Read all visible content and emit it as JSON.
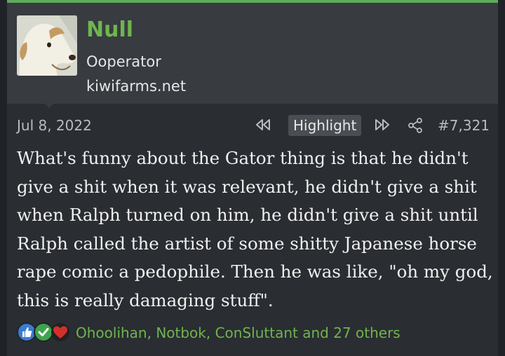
{
  "user": {
    "name": "Null",
    "title": "Ooperator",
    "banner": "kiwifarms.net"
  },
  "post": {
    "date": "Jul 8, 2022",
    "highlight_label": "Highlight",
    "number": "#7,321",
    "body": "What's funny about the Gator thing is that he didn't give a shit when it was relevant, he didn't give a shit when Ralph turned on him, he didn't give a shit until Ralph called the artist of some shitty Japanese horse rape comic a pedophile. Then he was like, \"oh my god, this is really damaging stuff\"."
  },
  "reactions": {
    "summary": "Ohoolihan, Notbok, ConSluttant and 27 others",
    "icons": [
      "like-icon",
      "check-icon",
      "heart-icon"
    ]
  },
  "colors": {
    "accent": "#6fb54f",
    "post_bg": "#2a2d32",
    "user_bg": "#383b40",
    "top_border": "#5eaa5c"
  }
}
